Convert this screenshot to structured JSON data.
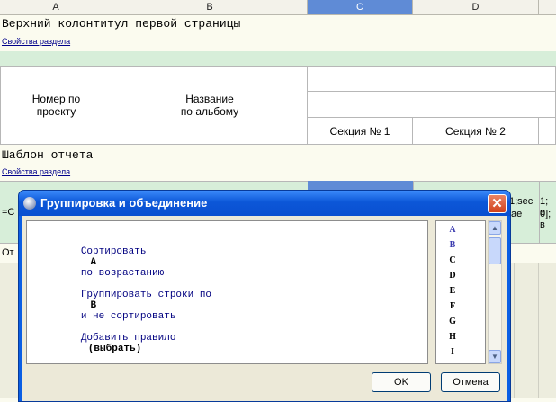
{
  "columns": [
    "A",
    "B",
    "C",
    "D"
  ],
  "header_section": {
    "title": "Верхний колонтитул первой страницы",
    "properties_link": "Свойства раздела"
  },
  "table_header": {
    "col_project_number": "Номер по\nпроекту",
    "col_album_name": "Название\nпо альбому",
    "section1": "Секция № 1",
    "section2": "Секция № 2"
  },
  "template_section": {
    "title": "Шаблон отчета",
    "properties_link": "Свойства раздела"
  },
  "bg_fragments": {
    "row_left": "=С",
    "row_right1": "1;sec",
    "row_right2": "ae",
    "row_right3": "1; е",
    "row_right4": "0]; в",
    "bottom_left": "От"
  },
  "dialog": {
    "title": "Группировка и объединение",
    "close": "✕",
    "rules": [
      {
        "a": "Сортировать",
        "b": "A",
        "c": "по возрастанию"
      },
      {
        "a": "Группировать строки по",
        "b": "B",
        "c": "и не сортировать"
      },
      {
        "a": "Добавить правило",
        "b": "(выбрать)"
      }
    ],
    "letters": [
      "A",
      "B",
      "C",
      "D",
      "E",
      "F",
      "G",
      "H",
      "I"
    ],
    "ok_label": "OK",
    "cancel_label": "Отмена"
  },
  "colors": {
    "selected_column": "#5f8bd6",
    "title_bar": "#0a5ee4",
    "dialog_text": "#000080"
  }
}
